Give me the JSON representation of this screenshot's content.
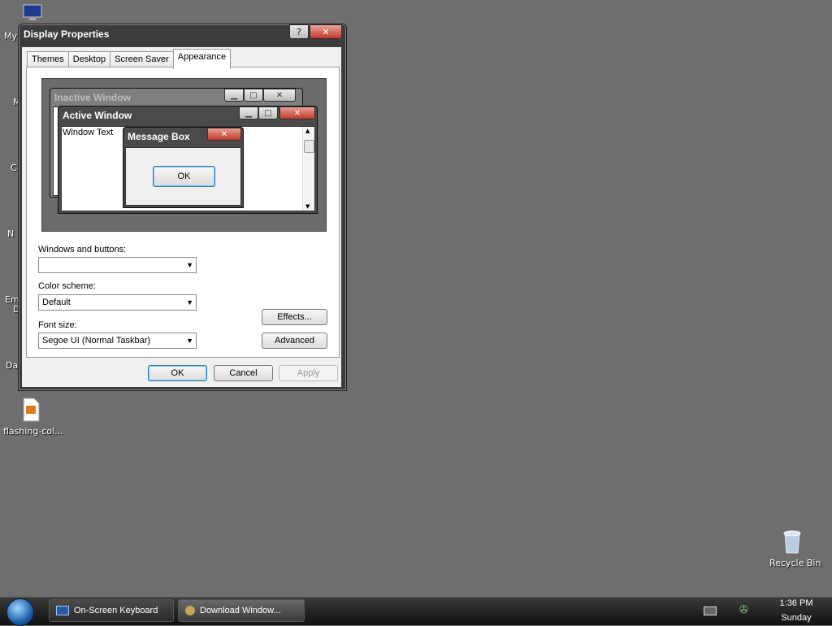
{
  "desktop": {
    "left_labels": [
      "My",
      "M",
      "C",
      "N",
      "Em",
      "D",
      "Da"
    ],
    "file_icon_label": "flashing-col...",
    "recycle_bin_label": "Recycle Bin"
  },
  "dialog": {
    "title": "Display Properties",
    "help_glyph": "?",
    "close_glyph": "✕",
    "tabs": [
      {
        "label": "Themes",
        "active": false
      },
      {
        "label": "Desktop",
        "active": false
      },
      {
        "label": "Screen Saver",
        "active": false
      },
      {
        "label": "Appearance",
        "active": true
      }
    ],
    "preview": {
      "inactive_title": "Inactive Window",
      "active_title": "Active Window",
      "window_text": "Window Text",
      "message_title": "Message Box",
      "ok_label": "OK"
    },
    "windows_buttons": {
      "label": "Windows and buttons:",
      "value": ""
    },
    "color_scheme": {
      "label": "Color scheme:",
      "value": "Default"
    },
    "font_size": {
      "label": "Font size:",
      "value": "Segoe UI (Normal Taskbar)"
    },
    "effects_label": "Effects...",
    "advanced_label": "Advanced",
    "ok_label": "OK",
    "cancel_label": "Cancel",
    "apply_label": "Apply"
  },
  "taskbar": {
    "items": [
      {
        "label": "On-Screen Keyboard",
        "icon": "keyboard-icon"
      },
      {
        "label": "Download Window...",
        "icon": "download-icon"
      }
    ],
    "clock_time": "1:36 PM",
    "clock_day": "Sunday"
  }
}
